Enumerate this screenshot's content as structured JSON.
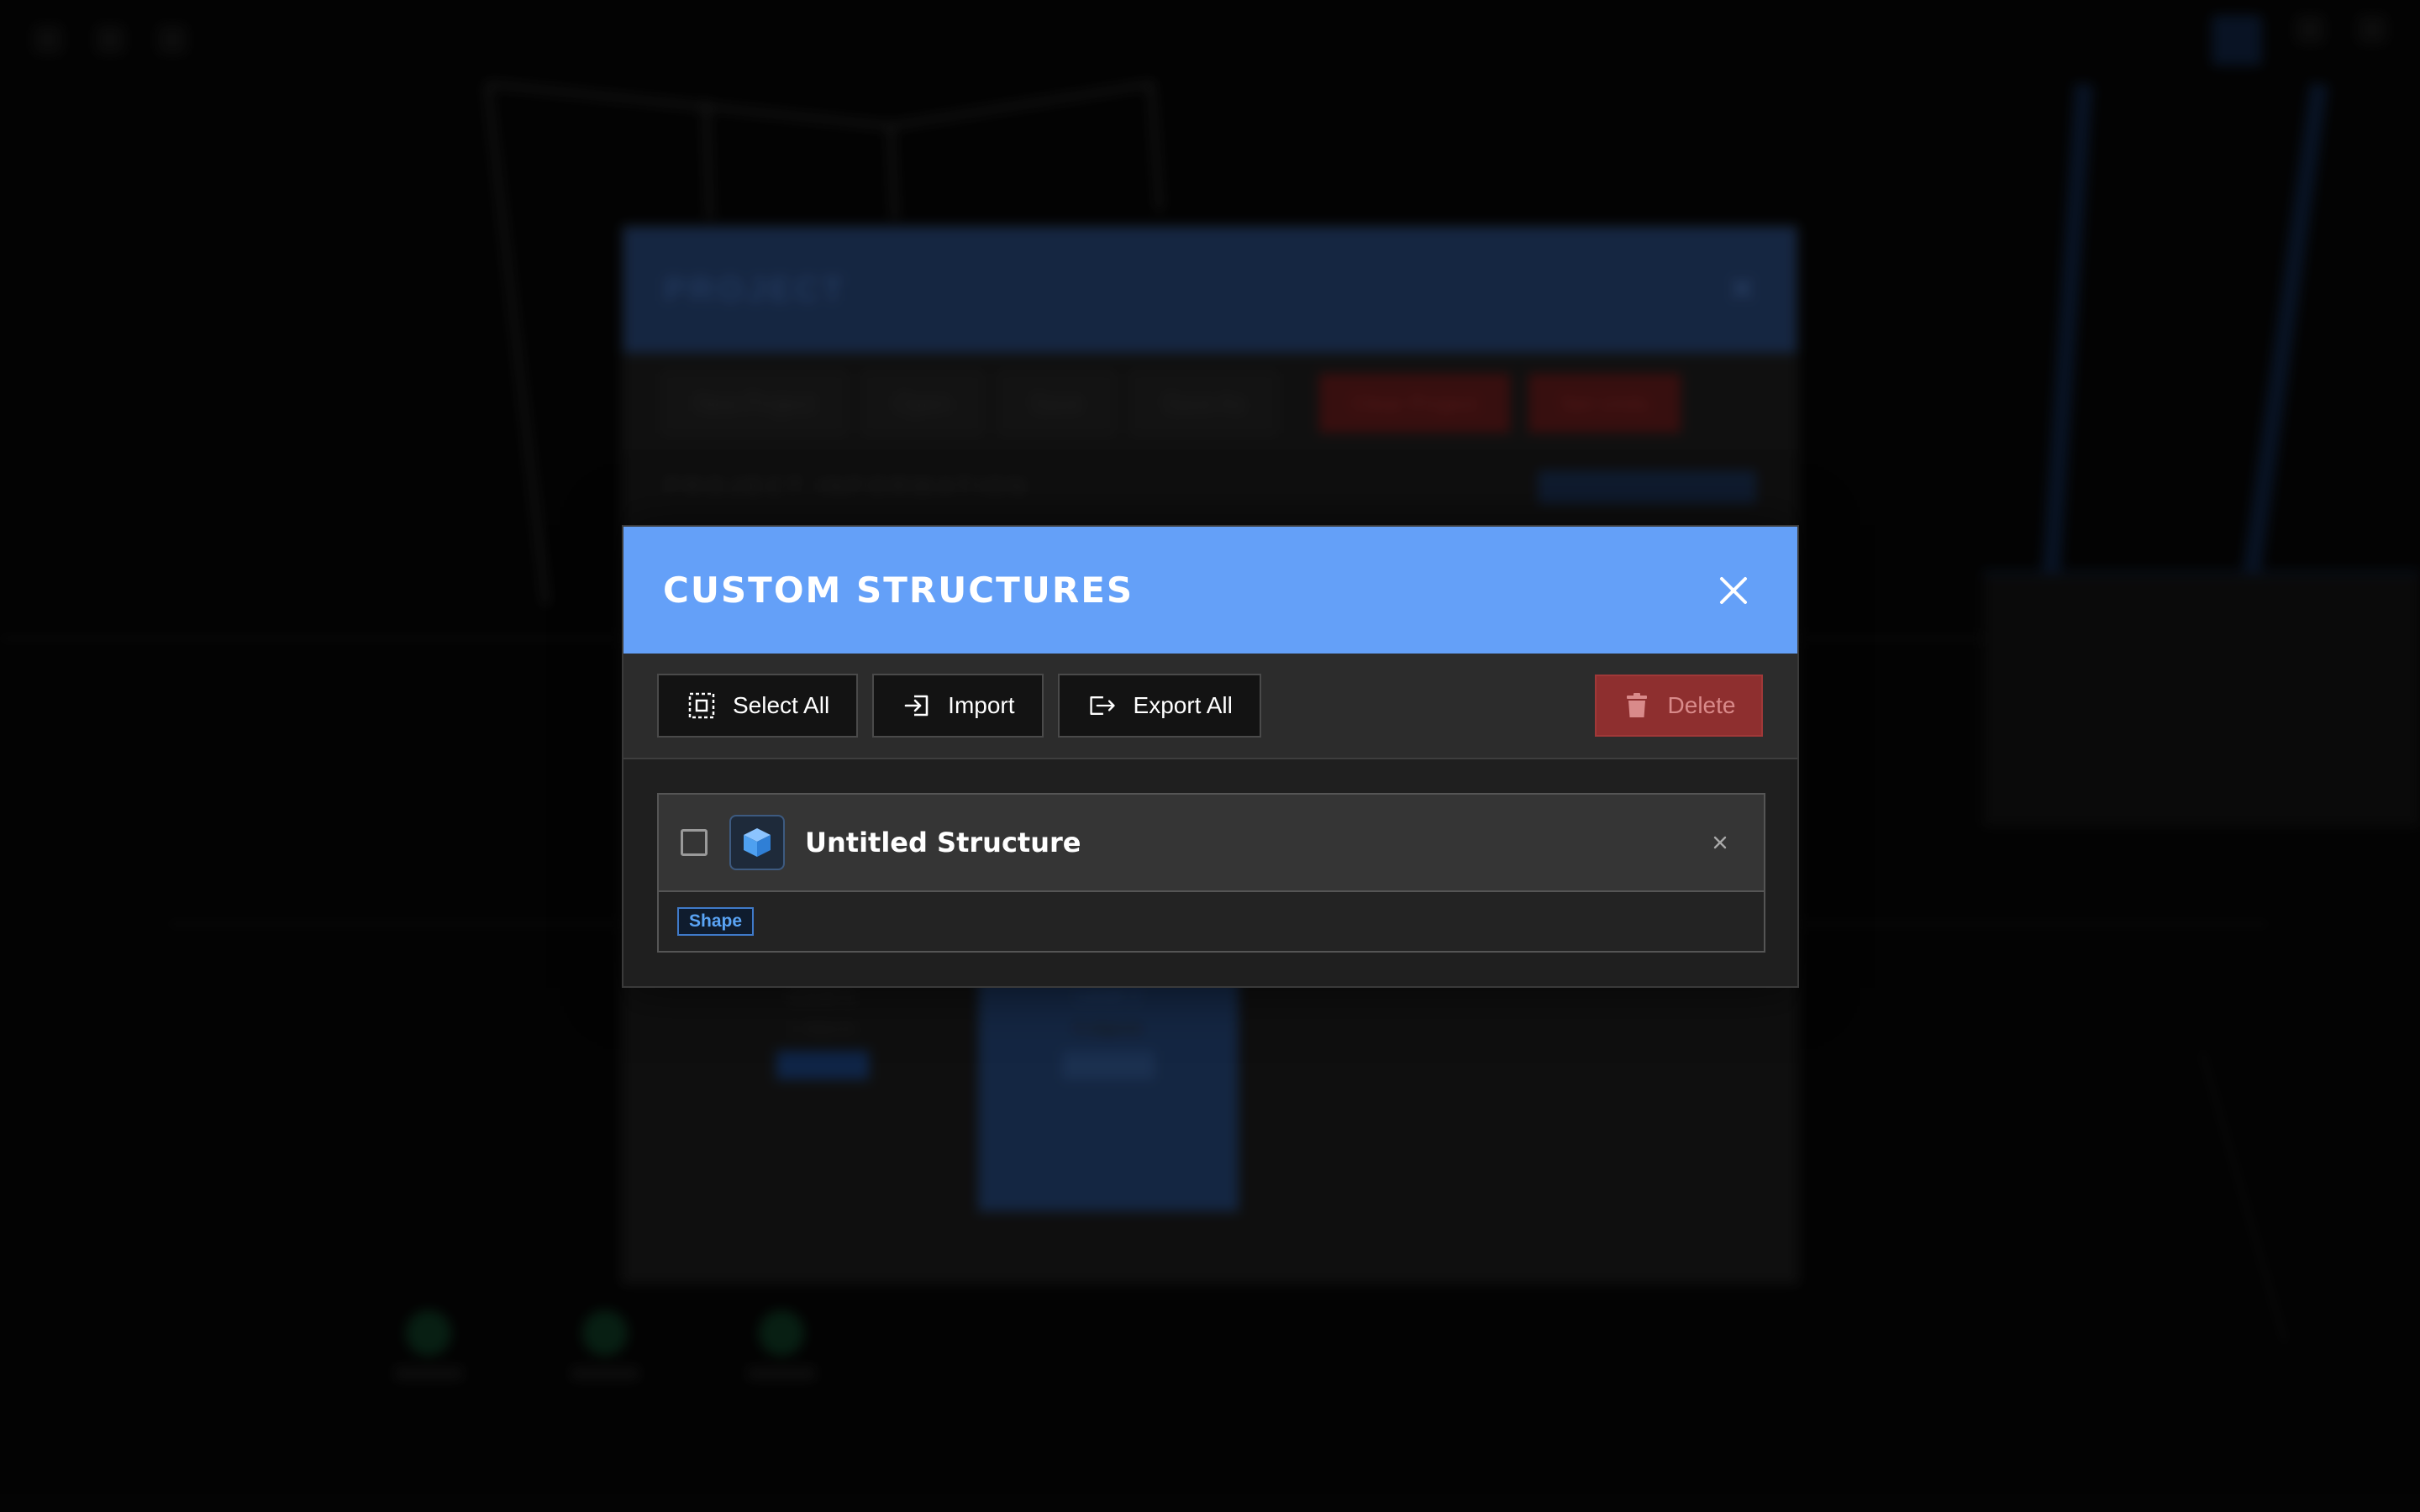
{
  "background": {
    "modal_title": "PROJECT",
    "toolbar": [
      "New Project",
      "Open",
      "Save",
      "Save As"
    ],
    "danger_buttons": [
      "Clear Project",
      "Set Units"
    ],
    "section_title": "PROJECT INFORMATION",
    "levels": [
      {
        "name": "Level 1",
        "sub": "1 objects"
      },
      {
        "name": "Level 2",
        "sub": "0 objects"
      }
    ]
  },
  "modal": {
    "title": "CUSTOM STRUCTURES",
    "close_icon": "close-icon",
    "toolbar": {
      "select_all_label": "Select All",
      "import_label": "Import",
      "export_all_label": "Export All",
      "delete_label": "Delete"
    },
    "items": [
      {
        "name": "Untitled Structure",
        "tag": "Shape",
        "checked": false
      }
    ]
  },
  "colors": {
    "header_blue": "#64a0f8",
    "delete_red": "#8e2f2f",
    "tag_blue": "#5aa4f5",
    "cube_blue": "#4ea0f0"
  }
}
